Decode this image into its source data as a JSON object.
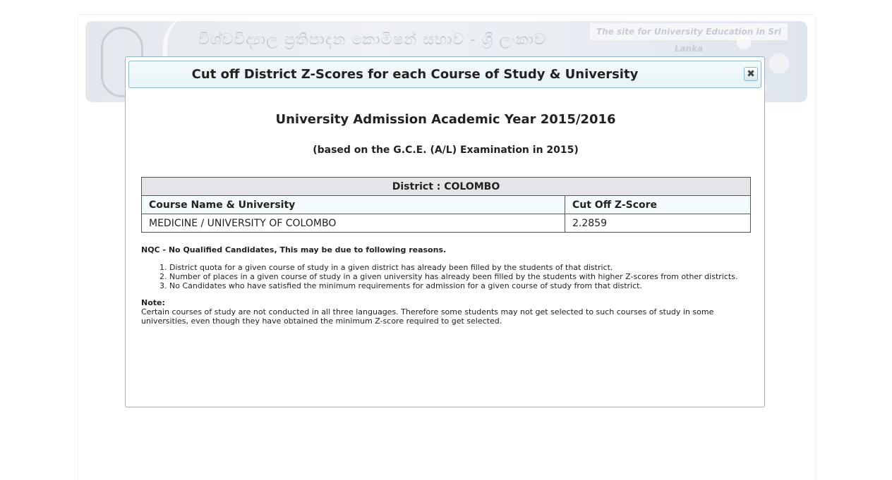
{
  "banner": {
    "title": "විශ්වවිද්‍යාල ප්‍රතිපාදන කොමිෂන් සභාව - ශ්‍රී ලංකාව",
    "tagline": "The site for University Education in Sri Lanka"
  },
  "modal": {
    "title": "Cut off District Z-Scores for each Course of Study & University",
    "close_label": "✖",
    "heading_year": "University Admission Academic Year 2015/2016",
    "heading_basis": "(based on the G.C.E. (A/L) Examination in 2015)"
  },
  "table": {
    "district_label": "District : COLOMBO",
    "columns": [
      "Course Name & University",
      "Cut Off Z-Score"
    ],
    "rows": [
      [
        "MEDICINE / UNIVERSITY OF COLOMBO",
        "2.2859"
      ]
    ]
  },
  "notes": {
    "nqc": "NQC - No Qualified Candidates, This may be due to following reasons.",
    "reasons": [
      "District quota for a given course of study in a given district has already been filled by the students of that district.",
      "Number of places in a given course of study in a given university has already been filled by the students with higher Z-scores from other districts.",
      "No Candidates who have satisfied the minimum requirements for admission for a given course of study from that district."
    ],
    "note_label": "Note:",
    "note_text": "Certain courses of study are not conducted in all three languages. Therefore some students may not get selected to such courses of study in some universities, even though they have obtained the minimum Z-score required to get selected."
  }
}
